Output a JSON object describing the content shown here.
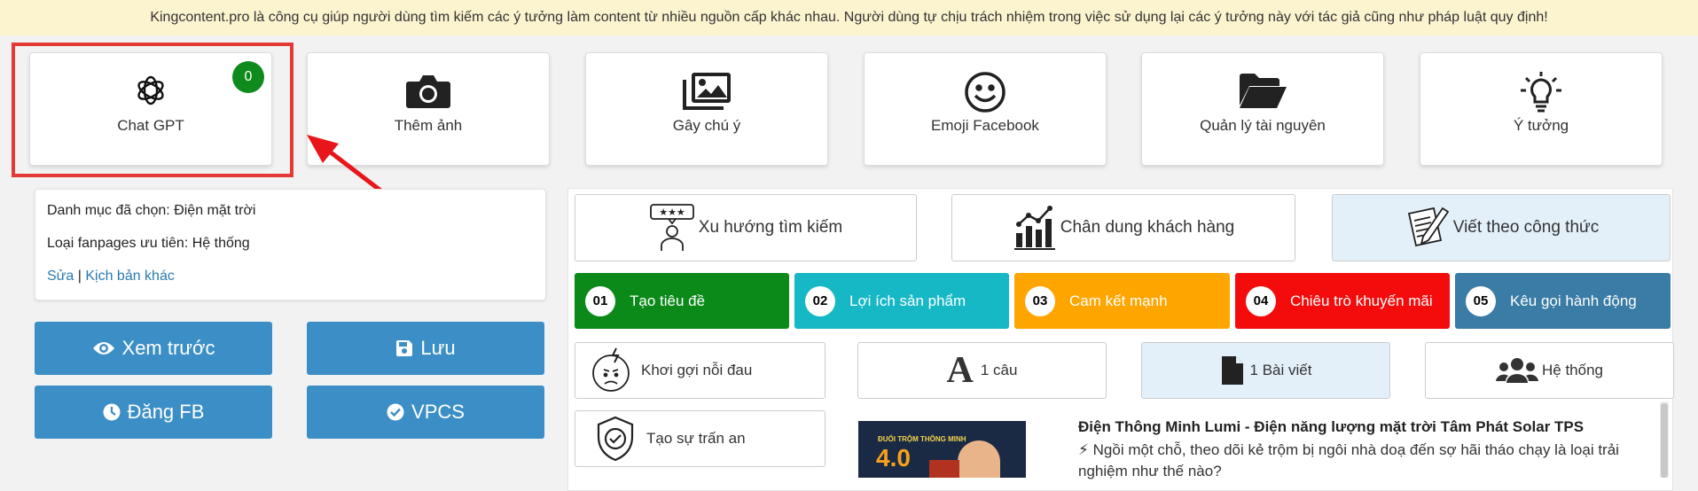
{
  "banner": "Kingcontent.pro là công cụ giúp người dùng tìm kiếm các ý tưởng làm content từ nhiều nguồn cấp khác nhau. Người dùng tự chịu trách nhiệm trong việc sử dụng lại các ý tưởng này với tác giả cũng như pháp luật quy định!",
  "tools": [
    {
      "label": "Chat GPT",
      "icon": "openai-icon",
      "badge": "0"
    },
    {
      "label": "Thêm ảnh",
      "icon": "camera-icon"
    },
    {
      "label": "Gây chú ý",
      "icon": "images-icon"
    },
    {
      "label": "Emoji Facebook",
      "icon": "smile-icon"
    },
    {
      "label": "Quản lý tài nguyên",
      "icon": "folder-open-icon"
    },
    {
      "label": "Ý tưởng",
      "icon": "lightbulb-icon"
    }
  ],
  "info": {
    "category": "Danh mục đã chọn: Điện mặt trời",
    "fanpage": "Loại fanpages ưu tiên: Hệ thống",
    "edit_link": "Sửa",
    "separator": "|",
    "other_link": "Kịch bản khác"
  },
  "actions": {
    "preview": "Xem trước",
    "save": "Lưu",
    "post_fb": "Đăng FB",
    "vpcs": "VPCS"
  },
  "categories": [
    {
      "label": "Xu hướng tìm kiếm",
      "icon": "rating-person-icon",
      "selected": false
    },
    {
      "label": "Chân dung khách hàng",
      "icon": "analytics-icon",
      "selected": false
    },
    {
      "label": "Viết theo công thức",
      "icon": "write-notes-icon",
      "selected": true
    }
  ],
  "steps": [
    {
      "num": "01",
      "label": "Tạo tiêu đề",
      "color": "#0b8a1a"
    },
    {
      "num": "02",
      "label": "Lợi ích sản phẩm",
      "color": "#17b8c5"
    },
    {
      "num": "03",
      "label": "Cam kết mạnh",
      "color": "#ffa500"
    },
    {
      "num": "04",
      "label": "Chiêu trò khuyến mãi",
      "color": "#f40c0c"
    },
    {
      "num": "05",
      "label": "Kêu gọi hành động",
      "color": "#3a7ca5"
    }
  ],
  "formulas": [
    {
      "label": "Khơi gợi nỗi đau",
      "icon": "pain-face-icon"
    },
    {
      "label": "Tạo sự trấn an",
      "icon": "shield-check-icon"
    }
  ],
  "lengths": [
    {
      "label": "1 câu",
      "icon": "font-a-icon",
      "selected": false
    },
    {
      "label": "1 Bài viết",
      "icon": "file-icon",
      "selected": true
    },
    {
      "label": "Hệ thống",
      "icon": "users-icon",
      "selected": false
    }
  ],
  "article": {
    "title": "Điện Thông Minh Lumi - Điện năng lượng mặt trời Tâm Phát Solar TPS",
    "desc": "⚡ Ngồi một chỗ, theo dõi kẻ trộm bị ngôi nhà doạ đến sợ hãi tháo chạy là loại trải nghiệm như thế nào?",
    "thumb_text": "ĐUỔI TRỘM THÔNG MINH",
    "thumb_big": "4.0"
  },
  "colors": {
    "button_blue": "#3c8fc6",
    "badge_green": "#0f8a1c",
    "highlight_red": "#e53935"
  }
}
